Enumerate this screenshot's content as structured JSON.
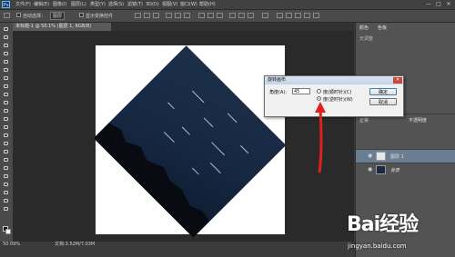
{
  "app": {
    "logo": "Ps",
    "menu": [
      "文件(F)",
      "编辑(E)",
      "图像(I)",
      "图层(L)",
      "类型(Y)",
      "选择(S)",
      "滤镜(T)",
      "3D(D)",
      "视图(V)",
      "窗口(W)",
      "帮助(H)"
    ],
    "window_buttons": [
      "—",
      "□",
      "✕"
    ]
  },
  "options_bar": {
    "auto_select_label": "自动选择：",
    "layer_label": "图层",
    "show_transform_label": "显示变换控件"
  },
  "document": {
    "tab_title": "未标题-1 @ 50.1% (图层 1, RGB/8)"
  },
  "status": {
    "zoom": "50.09%",
    "doc_info": "文档:3.52M/7.03M"
  },
  "panels": {
    "top_tabs": [
      "颜色",
      "色板"
    ],
    "top_sub": "无调整",
    "layers_header": "正常",
    "layers_opacity": "不透明度",
    "layers": [
      {
        "name": "图层 1"
      },
      {
        "name": "背景"
      }
    ]
  },
  "dialog": {
    "title": "旋转画布",
    "angle_label": "角度(A):",
    "angle_value": "45",
    "unit": "度",
    "cw_label": "度(顺时针)(C)",
    "ccw_label": "度(逆时针)(W)",
    "ok_label": "确定",
    "cancel_label": "取消",
    "selected": "ccw"
  },
  "watermark": {
    "brand": "Bai经验",
    "url": "jingyan.baidu.com"
  },
  "colors": {
    "accent_arrow": "#e0211b",
    "canvas": "#ffffff",
    "night_sky": "#1c2f49"
  }
}
